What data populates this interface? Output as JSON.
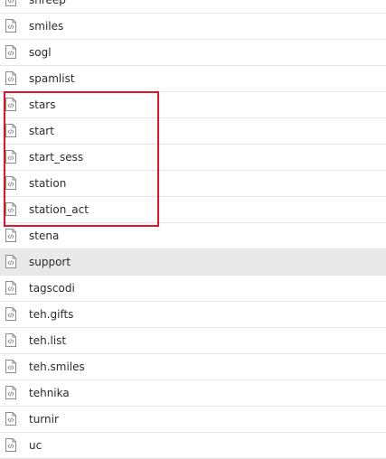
{
  "file_list": {
    "items": [
      {
        "name": "shreep",
        "icon": "code-file-icon"
      },
      {
        "name": "smiles",
        "icon": "code-file-icon"
      },
      {
        "name": "sogl",
        "icon": "code-file-icon"
      },
      {
        "name": "spamlist",
        "icon": "code-file-icon"
      },
      {
        "name": "stars",
        "icon": "code-file-icon"
      },
      {
        "name": "start",
        "icon": "code-file-icon"
      },
      {
        "name": "start_sess",
        "icon": "code-file-icon"
      },
      {
        "name": "station",
        "icon": "code-file-icon"
      },
      {
        "name": "station_act",
        "icon": "code-file-icon"
      },
      {
        "name": "stena",
        "icon": "code-file-icon"
      },
      {
        "name": "support",
        "icon": "code-file-icon",
        "hovered": true
      },
      {
        "name": "tagscodi",
        "icon": "code-file-icon"
      },
      {
        "name": "teh.gifts",
        "icon": "code-file-icon"
      },
      {
        "name": "teh.list",
        "icon": "code-file-icon"
      },
      {
        "name": "teh.smiles",
        "icon": "code-file-icon"
      },
      {
        "name": "tehnika",
        "icon": "code-file-icon"
      },
      {
        "name": "turnir",
        "icon": "code-file-icon"
      },
      {
        "name": "uc",
        "icon": "code-file-icon"
      }
    ]
  },
  "annotation": {
    "highlight_color": "#e2141f",
    "highlighted_items": [
      "stars",
      "start",
      "start_sess",
      "station",
      "station_act"
    ]
  },
  "colors": {
    "hover_row_bg": "#e9e9ea",
    "row_divider": "#e4e4e4",
    "icon_stroke": "#8a8a8a",
    "text": "#2b2b2b"
  }
}
